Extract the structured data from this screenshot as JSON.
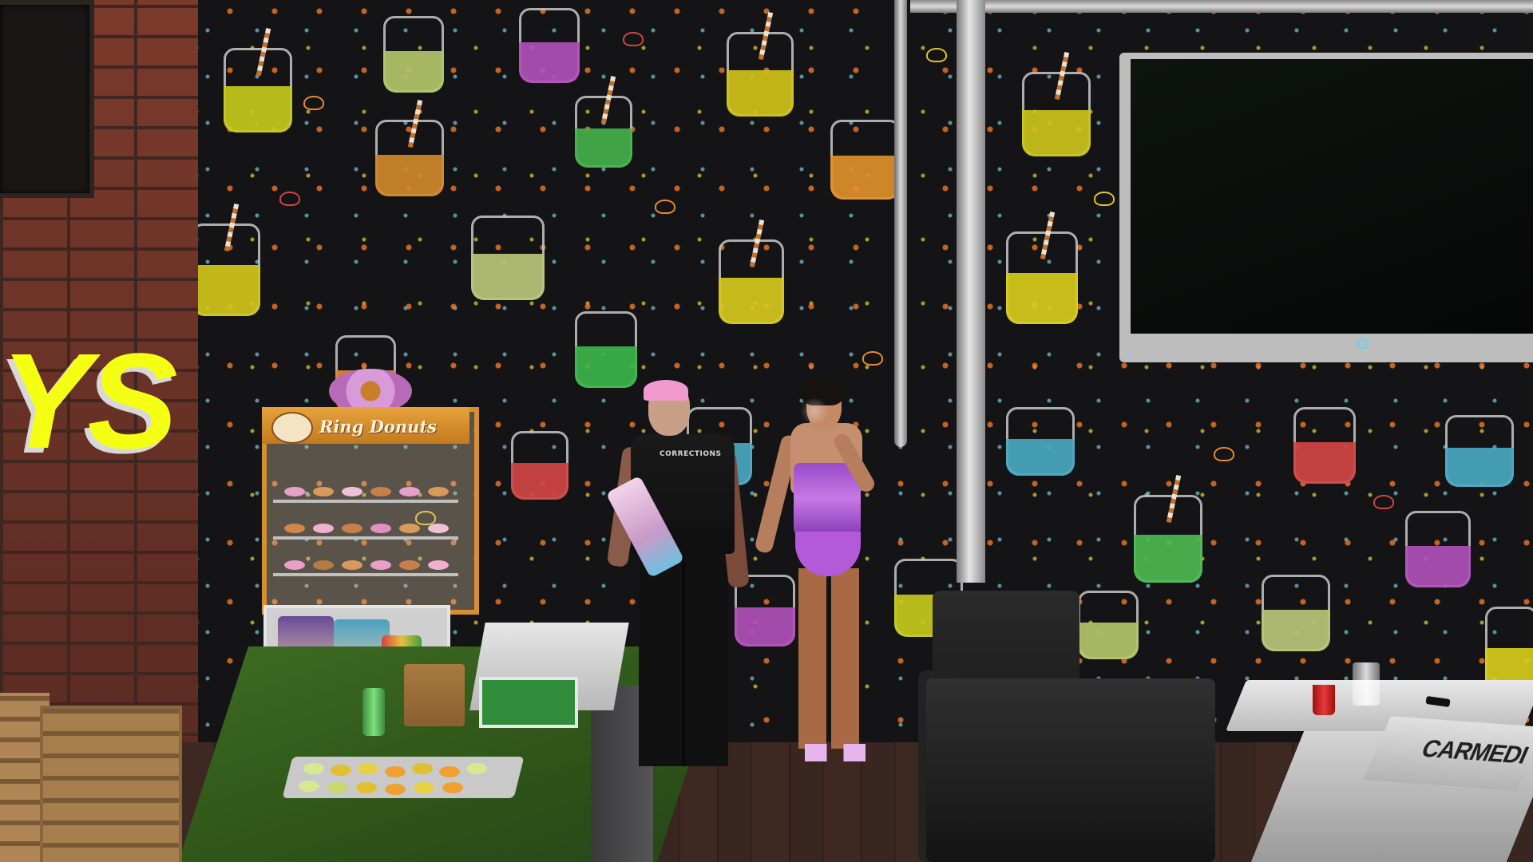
{
  "scene": {
    "cabinet_sign": "Ring Donuts",
    "neon_sign_text": "YS",
    "vest_text": "CORRECTIONS",
    "magazine_title": "CARMEDI"
  },
  "colors": {
    "wall": "#141416",
    "neon_yellow": "#f5ff14",
    "cabinet_orange": "#d6902c",
    "counter_green": "#2e5418",
    "officer_hair_pink": "#f09ad0",
    "corset_purple": "#b25ad8",
    "tv_led_blue": "#5fd3ff"
  },
  "icons": {
    "tv_standby": "tv-standby-led-icon",
    "cabinet_logo": "ring-donuts-logo-icon"
  }
}
